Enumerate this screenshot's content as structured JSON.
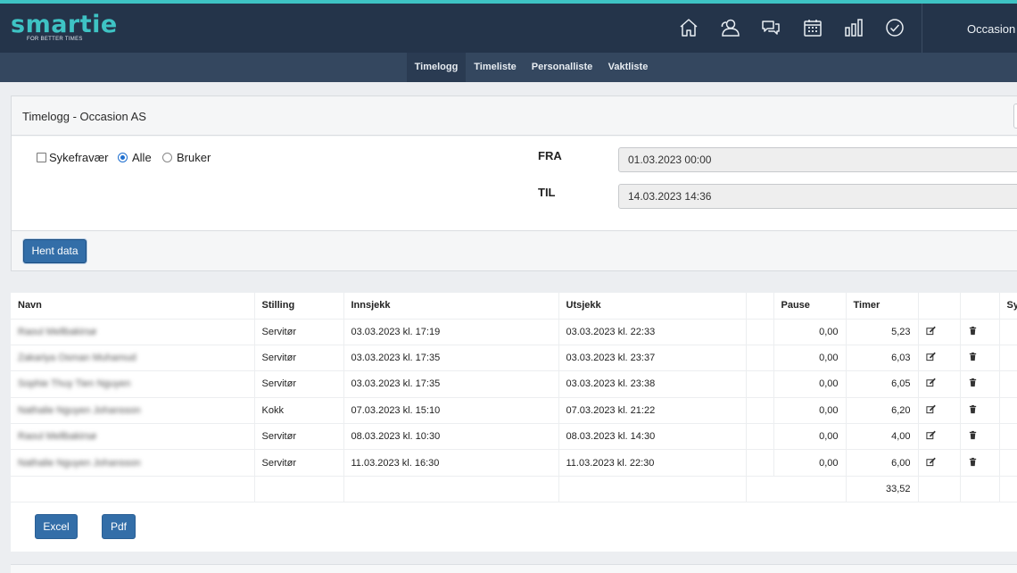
{
  "brand": {
    "name": "smartie",
    "tagline": "FOR BETTER TIMES",
    "accent": "#3ec3c4",
    "navy": "#24344a"
  },
  "nav_icons": [
    "home-icon",
    "users-icon",
    "chat-icon",
    "calendar-icon",
    "bar-chart-icon",
    "check-circle-icon"
  ],
  "company": "Occasion A",
  "subnav": {
    "tabs": [
      "Timelogg",
      "Timeliste",
      "Personalliste",
      "Vaktliste"
    ],
    "active": "Timelogg"
  },
  "panel": {
    "title": "Timelogg - Occasion AS",
    "filters": {
      "sick_label": "Sykefravær",
      "sick_checked": false,
      "all_label": "Alle",
      "user_label": "Bruker",
      "selected": "Alle"
    },
    "from_label": "FRA",
    "from_value": "01.03.2023 00:00",
    "to_label": "TIL",
    "to_value": "14.03.2023 14:36",
    "fetch_button": "Hent data"
  },
  "table": {
    "headers": [
      "Navn",
      "Stilling",
      "Innsjekk",
      "Utsjekk",
      "",
      "Pause",
      "Timer",
      "",
      "",
      "Syk"
    ],
    "rows": [
      {
        "name": "Raoul Mellbakirsø",
        "position": "Servitør",
        "checkin": "03.03.2023 kl. 17:19",
        "checkout": "03.03.2023 kl. 22:33",
        "pause": "0,00",
        "hours": "5,23"
      },
      {
        "name": "Zakariya Osman Muhamud",
        "position": "Servitør",
        "checkin": "03.03.2023 kl. 17:35",
        "checkout": "03.03.2023 kl. 23:37",
        "pause": "0,00",
        "hours": "6,03"
      },
      {
        "name": "Sophie Thuy Tien Nguyen",
        "position": "Servitør",
        "checkin": "03.03.2023 kl. 17:35",
        "checkout": "03.03.2023 kl. 23:38",
        "pause": "0,00",
        "hours": "6,05"
      },
      {
        "name": "Nathalie Nguyen Johansson",
        "position": "Kokk",
        "checkin": "07.03.2023 kl. 15:10",
        "checkout": "07.03.2023 kl. 21:22",
        "pause": "0,00",
        "hours": "6,20"
      },
      {
        "name": "Raoul Mellbakirsø",
        "position": "Servitør",
        "checkin": "08.03.2023 kl. 10:30",
        "checkout": "08.03.2023 kl. 14:30",
        "pause": "0,00",
        "hours": "4,00"
      },
      {
        "name": "Nathalie Nguyen Johansson",
        "position": "Servitør",
        "checkin": "11.03.2023 kl. 16:30",
        "checkout": "11.03.2023 kl. 22:30",
        "pause": "0,00",
        "hours": "6,00"
      }
    ],
    "total_hours": "33,52",
    "row_action_icons": [
      "edit-icon",
      "trash-icon"
    ]
  },
  "export": {
    "excel": "Excel",
    "pdf": "Pdf"
  }
}
